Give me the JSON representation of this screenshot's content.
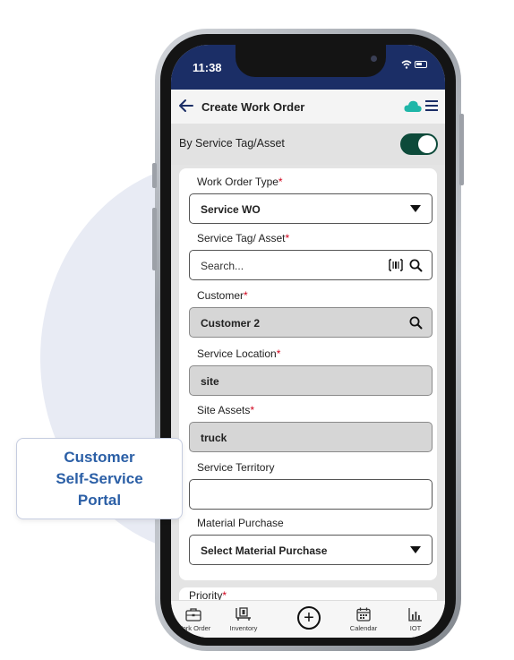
{
  "status": {
    "time": "11:38"
  },
  "appbar": {
    "title": "Create Work Order",
    "back_icon": "arrow-left-icon",
    "cloud_icon": "cloud-icon",
    "menu_icon": "hamburger-menu-icon",
    "cloud_color": "#1fb6a8"
  },
  "toggle": {
    "label": "By Service Tag/Asset",
    "on": true,
    "color": "#0d4a3a"
  },
  "form": {
    "work_order_type": {
      "label": "Work Order Type",
      "required": "*",
      "value": "Service WO"
    },
    "service_tag": {
      "label": "Service Tag/ Asset",
      "required": "*",
      "placeholder": "Search..."
    },
    "customer": {
      "label": "Customer",
      "required": "*",
      "value": "Customer 2"
    },
    "service_location": {
      "label": "Service Location",
      "required": "*",
      "value": "site"
    },
    "site_assets": {
      "label": "Site Assets",
      "required": "*",
      "value": "truck"
    },
    "service_territory": {
      "label": "Service Territory",
      "value": ""
    },
    "material_purchase": {
      "label": "Material Purchase",
      "value": "Select Material Purchase"
    },
    "priority": {
      "label": "Priority",
      "required": "*"
    }
  },
  "bottom_nav": [
    {
      "label": "Work Order",
      "icon": "briefcase-icon"
    },
    {
      "label": "Inventory",
      "icon": "boxes-icon"
    },
    {
      "label": "",
      "icon": "add-circle-icon"
    },
    {
      "label": "Calendar",
      "icon": "calendar-icon"
    },
    {
      "label": "IOT",
      "icon": "bar-chart-icon"
    }
  ],
  "badge": {
    "line1": "Customer",
    "line2": "Self-Service",
    "line3": "Portal"
  },
  "colors": {
    "header": "#1b2e66",
    "accent_text": "#2b5fa6",
    "required": "#d0021b"
  }
}
